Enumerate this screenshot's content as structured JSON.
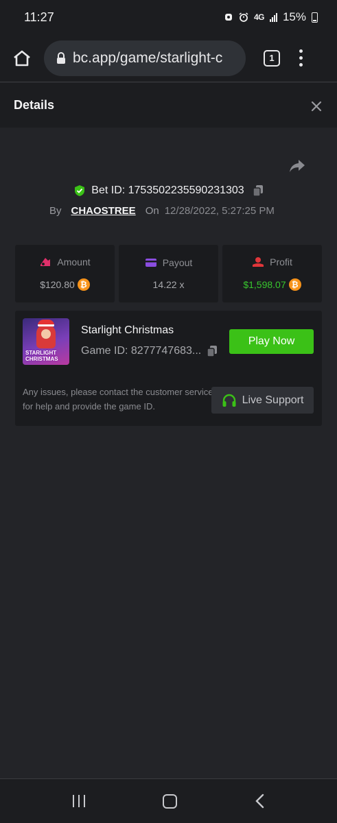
{
  "status_bar": {
    "time": "11:27",
    "network": "4G",
    "battery": "15%"
  },
  "browser": {
    "url": "bc.app/game/starlight-c",
    "tab_count": "1"
  },
  "details": {
    "title": "Details"
  },
  "bet": {
    "bet_id_label": "Bet ID: 1753502235590231303",
    "by_label": "By",
    "username": "CHAOSTREE",
    "on_label": "On",
    "datetime": "12/28/2022, 5:27:25 PM"
  },
  "stats": {
    "amount_label": "Amount",
    "amount_value": "$120.80",
    "payout_label": "Payout",
    "payout_value": "14.22 x",
    "profit_label": "Profit",
    "profit_value": "$1,598.07"
  },
  "game": {
    "name": "Starlight Christmas",
    "game_id": "Game ID: 8277747683...",
    "thumb_text_line1": "STARLIGHT",
    "thumb_text_line2": "CHRISTMAS",
    "play_label": "Play Now",
    "support_text": "Any issues, please contact the customer service for help and provide the game ID.",
    "support_label": "Live Support"
  },
  "colors": {
    "accent_green": "#3bc117",
    "profit_green": "#38c72e",
    "bitcoin_orange": "#f7931a",
    "background": "#232428"
  },
  "icons": {
    "btc_glyph": "₿"
  }
}
